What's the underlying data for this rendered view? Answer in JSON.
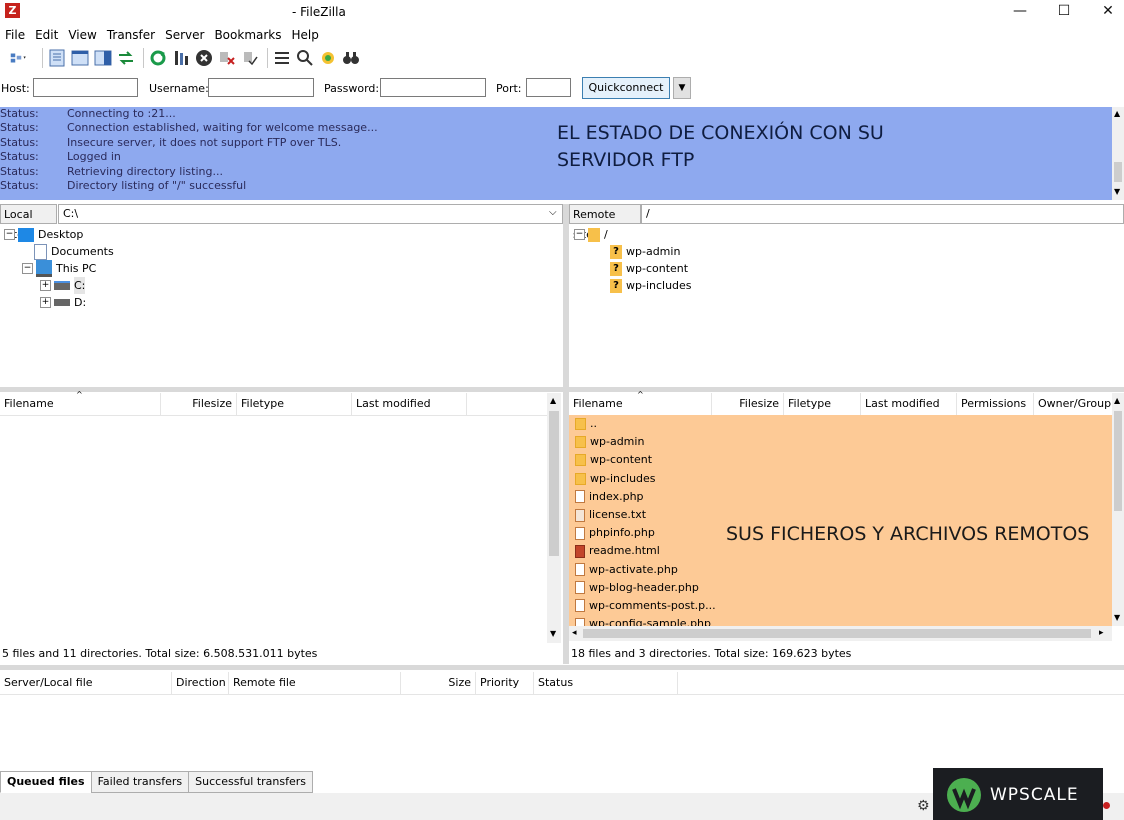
{
  "window": {
    "title": "- FileZilla",
    "controls": {
      "minimize": "—",
      "maximize": "☐",
      "close": "✕"
    }
  },
  "menu": [
    "File",
    "Edit",
    "View",
    "Transfer",
    "Server",
    "Bookmarks",
    "Help"
  ],
  "quickconnect": {
    "host_label": "Host:",
    "host_value": "",
    "username_label": "Username:",
    "username_value": "",
    "password_label": "Password:",
    "password_value": "",
    "port_label": "Port:",
    "port_value": "",
    "button": "Quickconnect"
  },
  "log": {
    "rows": [
      {
        "key": "Status:",
        "text": "Connecting to                    :21..."
      },
      {
        "key": "Status:",
        "text": "Connection established, waiting for welcome message..."
      },
      {
        "key": "Status:",
        "text": "Insecure server, it does not support FTP over TLS."
      },
      {
        "key": "Status:",
        "text": "Logged in"
      },
      {
        "key": "Status:",
        "text": "Retrieving directory listing..."
      },
      {
        "key": "Status:",
        "text": "Directory listing of \"/\" successful"
      }
    ],
    "overlay": "EL ESTADO DE CONEXIÓN CON SU SERVIDOR FTP",
    "highlight_color": "#8ea9ef"
  },
  "local": {
    "site_label": "Local site:",
    "path": "C:\\",
    "tree": [
      {
        "label": "Desktop",
        "icon": "desktop-icon"
      },
      {
        "label": "Documents",
        "icon": "documents-icon"
      },
      {
        "label": "This PC",
        "icon": "computer-icon"
      },
      {
        "label": "C:",
        "icon": "drive-icon"
      },
      {
        "label": "D:",
        "icon": "drive-icon"
      }
    ],
    "columns": [
      "Filename",
      "Filesize",
      "Filetype",
      "Last modified"
    ],
    "status": "5 files and 11 directories. Total size: 6.508.531.011 bytes"
  },
  "remote": {
    "site_label": "Remote site:",
    "path": "/",
    "tree": [
      {
        "label": "/",
        "icon": "folder-icon"
      },
      {
        "label": "wp-admin",
        "icon": "unknown-folder-icon"
      },
      {
        "label": "wp-content",
        "icon": "unknown-folder-icon"
      },
      {
        "label": "wp-includes",
        "icon": "unknown-folder-icon"
      }
    ],
    "columns": [
      "Filename",
      "Filesize",
      "Filetype",
      "Last modified",
      "Permissions",
      "Owner/Group"
    ],
    "files": [
      {
        "name": "..",
        "type": "folder"
      },
      {
        "name": "wp-admin",
        "type": "folder"
      },
      {
        "name": "wp-content",
        "type": "folder"
      },
      {
        "name": "wp-includes",
        "type": "folder"
      },
      {
        "name": "index.php",
        "type": "file"
      },
      {
        "name": "license.txt",
        "type": "text"
      },
      {
        "name": "phpinfo.php",
        "type": "file"
      },
      {
        "name": "readme.html",
        "type": "html"
      },
      {
        "name": "wp-activate.php",
        "type": "file"
      },
      {
        "name": "wp-blog-header.php",
        "type": "file"
      },
      {
        "name": "wp-comments-post.p...",
        "type": "file"
      },
      {
        "name": "wp-config-sample.php",
        "type": "file"
      }
    ],
    "overlay": "SUS FICHEROS Y ARCHIVOS REMOTOS",
    "highlight_color": "#fdca96",
    "status": "18 files and 3 directories. Total size: 169.623 bytes"
  },
  "queue": {
    "columns": [
      "Server/Local file",
      "Direction",
      "Remote file",
      "Size",
      "Priority",
      "Status"
    ],
    "tabs": [
      "Queued files",
      "Failed transfers",
      "Successful transfers"
    ]
  },
  "watermark": {
    "text": "WPSCALE"
  }
}
